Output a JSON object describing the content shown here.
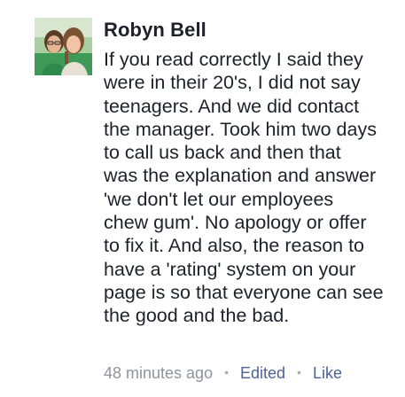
{
  "comment": {
    "author": "Robyn Bell",
    "avatar": "profile-photo",
    "body_lines": [
      "If you read correctly I said they",
      "were in their 20's, I did not say",
      "teenagers. And we did contact",
      "the manager. Took him two days",
      "to call us back and then that",
      "was the explanation and answer",
      "'we don't let our employees",
      "chew gum'. No apology or offer",
      "to fix it. And also, the reason to",
      "have a 'rating' system on your",
      "page is so that everyone can see",
      "the good and the bad."
    ],
    "timestamp": "48 minutes ago",
    "separator": "•",
    "edited_label": "Edited",
    "like_label": "Like"
  },
  "colors": {
    "text": "#1d2129",
    "meta": "#90949c",
    "link": "#4b6398"
  }
}
